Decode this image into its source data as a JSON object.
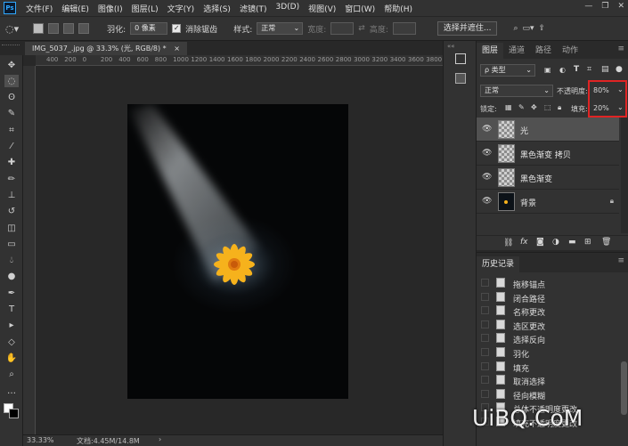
{
  "app": {
    "logo": "Ps",
    "window_controls": [
      "—",
      "❐",
      "✕"
    ]
  },
  "menu": [
    "文件(F)",
    "编辑(E)",
    "图像(I)",
    "图层(L)",
    "文字(Y)",
    "选择(S)",
    "滤镜(T)",
    "3D(D)",
    "视图(V)",
    "窗口(W)",
    "帮助(H)"
  ],
  "options": {
    "feather_label": "羽化:",
    "feather_value": "0 像素",
    "antialias_label": "消除锯齿",
    "style_label": "样式:",
    "style_value": "正常",
    "width_label": "宽度:",
    "height_label": "高度:",
    "select_mask_button": "选择并遮住..."
  },
  "document": {
    "tab_title": "IMG_5037_.jpg @ 33.3% (光, RGB/8) *",
    "zoom": "33.33%",
    "doc_info": "文档:4.45M/14.8M"
  },
  "ruler": {
    "top": [
      "400",
      "200",
      "0",
      "200",
      "400",
      "600",
      "800",
      "1000",
      "1200",
      "1400",
      "1600",
      "1800",
      "2000",
      "2200",
      "2400",
      "2600",
      "2800",
      "3000",
      "3200",
      "3400",
      "3600",
      "3800",
      "40"
    ]
  },
  "tools": [
    "move-tool",
    "marquee-tool",
    "lasso-tool",
    "quick-select-tool",
    "crop-tool",
    "eyedropper-tool",
    "healing-tool",
    "brush-tool",
    "stamp-tool",
    "history-brush-tool",
    "eraser-tool",
    "gradient-tool",
    "blur-tool",
    "dodge-tool",
    "pen-tool",
    "type-tool",
    "path-select-tool",
    "shape-tool",
    "hand-tool",
    "zoom-tool",
    "more-tool"
  ],
  "layers_panel": {
    "tabs": [
      "图层",
      "通道",
      "路径",
      "动作"
    ],
    "filter_label": "ρ 类型",
    "blend_mode": "正常",
    "opacity_label": "不透明度:",
    "opacity_value": "80%",
    "lock_label": "锁定:",
    "fill_label": "填充:",
    "fill_value": "20%",
    "layers": [
      {
        "name": "光",
        "selected": true,
        "locked": false
      },
      {
        "name": "黑色渐变 拷贝",
        "selected": false,
        "locked": false
      },
      {
        "name": "黑色渐变",
        "selected": false,
        "locked": false
      },
      {
        "name": "背景",
        "selected": false,
        "locked": true
      }
    ],
    "bottom_icons": [
      "link-icon",
      "fx-icon",
      "mask-icon",
      "adjustment-icon",
      "group-icon",
      "new-layer-icon",
      "trash-icon"
    ],
    "bottom_fx": "fx"
  },
  "history_panel": {
    "title": "历史记录",
    "items": [
      "拖移锚点",
      "闭合路径",
      "名称更改",
      "选区更改",
      "选择反向",
      "羽化",
      "填充",
      "取消选择",
      "径向模糊",
      "总体不透明度更改",
      "填充不透明度更改"
    ]
  },
  "watermark": "UiBQ.CoM",
  "colors": {
    "accent_red": "#e02424",
    "ps_blue": "#31a8ff",
    "flower": "#f6b21c"
  }
}
